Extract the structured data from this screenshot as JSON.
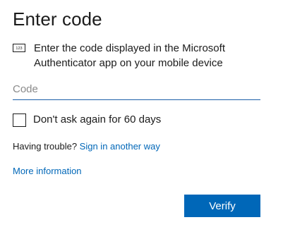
{
  "title": "Enter code",
  "description": "Enter the code displayed in the Microsoft Authenticator app on your mobile device",
  "code_icon_text": "123",
  "code_input": {
    "placeholder": "Code",
    "value": ""
  },
  "remember_checkbox": {
    "label": "Don't ask again for 60 days",
    "checked": false
  },
  "trouble": {
    "prefix": "Having trouble?",
    "link_label": "Sign in another way"
  },
  "more_info_label": "More information",
  "verify_button_label": "Verify",
  "colors": {
    "accent": "#0067b8",
    "text": "#1b1b1b",
    "placeholder": "#8a8a8a"
  },
  "icons": {
    "code": "numeric-code-icon"
  }
}
